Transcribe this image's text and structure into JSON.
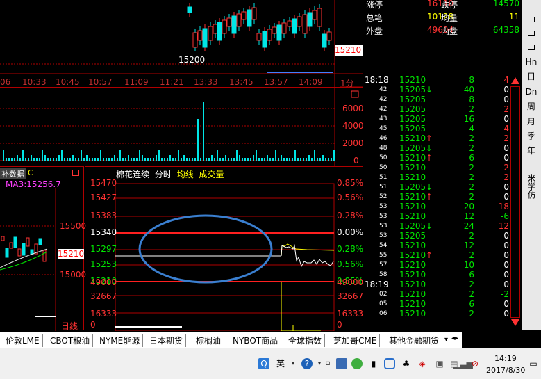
{
  "top_chart": {
    "time_labels": [
      "06",
      "10:33",
      "10:45",
      "10:57",
      "11:09",
      "11:21",
      "13:33",
      "13:45",
      "13:57",
      "14:09",
      "1分"
    ],
    "low_label": "15200",
    "price_tag": "15210"
  },
  "volume_chart": {
    "y_labels": [
      "6000",
      "4000",
      "2000",
      "0"
    ]
  },
  "kline": {
    "tab_supp": "补数据",
    "tab_c": "C",
    "ma3": "MA3:15256.7",
    "y_labels": [
      "15500",
      "15000"
    ],
    "price_tag": "15210",
    "tab_day": "日线"
  },
  "intraday": {
    "header": {
      "name": "棉花连续",
      "mode": "分时",
      "avg": "均线",
      "vol": "成交量"
    },
    "price_levels": [
      "15470",
      "15427",
      "15383",
      "15340",
      "15297",
      "15253",
      "15210"
    ],
    "pct_levels": [
      "0.85%",
      "0.56%",
      "0.28%",
      "0.00%",
      "0.28%",
      "0.56%",
      "0.85%"
    ],
    "vol_left": [
      "49000",
      "32667",
      "16333",
      "0"
    ],
    "vol_right": [
      "49000",
      "32667",
      "16333",
      "0"
    ]
  },
  "quote": {
    "rows": [
      {
        "l1": "涨停",
        "v1": "16110",
        "l2": "跌停",
        "v2": "14570"
      },
      {
        "l1": "总笔",
        "v1": "10128",
        "l2": "均量",
        "v2": "11"
      },
      {
        "l1": "外盘",
        "v1": "49604",
        "l2": "内盘",
        "v2": "64358"
      }
    ]
  },
  "ticks": [
    {
      "t": "18:18",
      "p": "15210",
      "a": "",
      "v": "8",
      "c": "4",
      "cc": "red"
    },
    {
      "t": ":42",
      "p": "15205",
      "a": "↓",
      "v": "40",
      "c": "0",
      "cc": "wht"
    },
    {
      "t": ":42",
      "p": "15205",
      "a": "",
      "v": "8",
      "c": "0",
      "cc": "wht"
    },
    {
      "t": ":42",
      "p": "15205",
      "a": "",
      "v": "2",
      "c": "2",
      "cc": "red"
    },
    {
      "t": ":43",
      "p": "15205",
      "a": "",
      "v": "16",
      "c": "0",
      "cc": "wht"
    },
    {
      "t": ":45",
      "p": "15205",
      "a": "",
      "v": "4",
      "c": "4",
      "cc": "red"
    },
    {
      "t": ":46",
      "p": "15210",
      "a": "↑",
      "v": "2",
      "c": "2",
      "cc": "red"
    },
    {
      "t": ":48",
      "p": "15205",
      "a": "↓",
      "v": "2",
      "c": "0",
      "cc": "wht"
    },
    {
      "t": ":50",
      "p": "15210",
      "a": "↑",
      "v": "6",
      "c": "0",
      "cc": "wht"
    },
    {
      "t": ":50",
      "p": "15210",
      "a": "",
      "v": "2",
      "c": "2",
      "cc": "red"
    },
    {
      "t": ":51",
      "p": "15210",
      "a": "",
      "v": "2",
      "c": "2",
      "cc": "red"
    },
    {
      "t": ":51",
      "p": "15205",
      "a": "↓",
      "v": "2",
      "c": "0",
      "cc": "wht"
    },
    {
      "t": ":52",
      "p": "15210",
      "a": "↑",
      "v": "2",
      "c": "0",
      "cc": "wht"
    },
    {
      "t": ":53",
      "p": "15210",
      "a": "",
      "v": "20",
      "c": "18",
      "cc": "red"
    },
    {
      "t": ":53",
      "p": "15210",
      "a": "",
      "v": "12",
      "c": "-6",
      "cc": "grn"
    },
    {
      "t": ":53",
      "p": "15205",
      "a": "↓",
      "v": "24",
      "c": "12",
      "cc": "red"
    },
    {
      "t": ":53",
      "p": "15205",
      "a": "",
      "v": "2",
      "c": "0",
      "cc": "wht"
    },
    {
      "t": ":54",
      "p": "15210",
      "a": "",
      "v": "12",
      "c": "0",
      "cc": "wht"
    },
    {
      "t": ":55",
      "p": "15210",
      "a": "↑",
      "v": "2",
      "c": "0",
      "cc": "wht"
    },
    {
      "t": ":57",
      "p": "15210",
      "a": "",
      "v": "10",
      "c": "0",
      "cc": "wht"
    },
    {
      "t": ":58",
      "p": "15210",
      "a": "",
      "v": "6",
      "c": "0",
      "cc": "wht"
    },
    {
      "t": "18:19",
      "p": "15210",
      "a": "",
      "v": "2",
      "c": "0",
      "cc": "wht"
    },
    {
      "t": ":02",
      "p": "15210",
      "a": "",
      "v": "2",
      "c": "-2",
      "cc": "grn"
    },
    {
      "t": ":05",
      "p": "15210",
      "a": "",
      "v": "6",
      "c": "0",
      "cc": "wht"
    },
    {
      "t": ":06",
      "p": "15210",
      "a": "",
      "v": "2",
      "c": "0",
      "cc": "wht"
    }
  ],
  "side_nav": [
    "Hn",
    "日",
    "Dn",
    "周",
    "月",
    "季",
    "年",
    "米学仿"
  ],
  "tabs": [
    "伦敦LME",
    "CBOT粮油",
    "NYME能源",
    "日本期货",
    "棕榈油",
    "NYBOT商品",
    "全球指数",
    "芝加哥CME",
    "其他金融期货"
  ],
  "taskbar": {
    "time": "14:19",
    "date": "2017/8/30",
    "ime": "英"
  },
  "colors": {
    "bg": "#000000",
    "grid": "#b00000",
    "up": "#ff3232",
    "down": "#00e600",
    "bar": "#00e6e6",
    "accent": "#3a7fd0"
  }
}
